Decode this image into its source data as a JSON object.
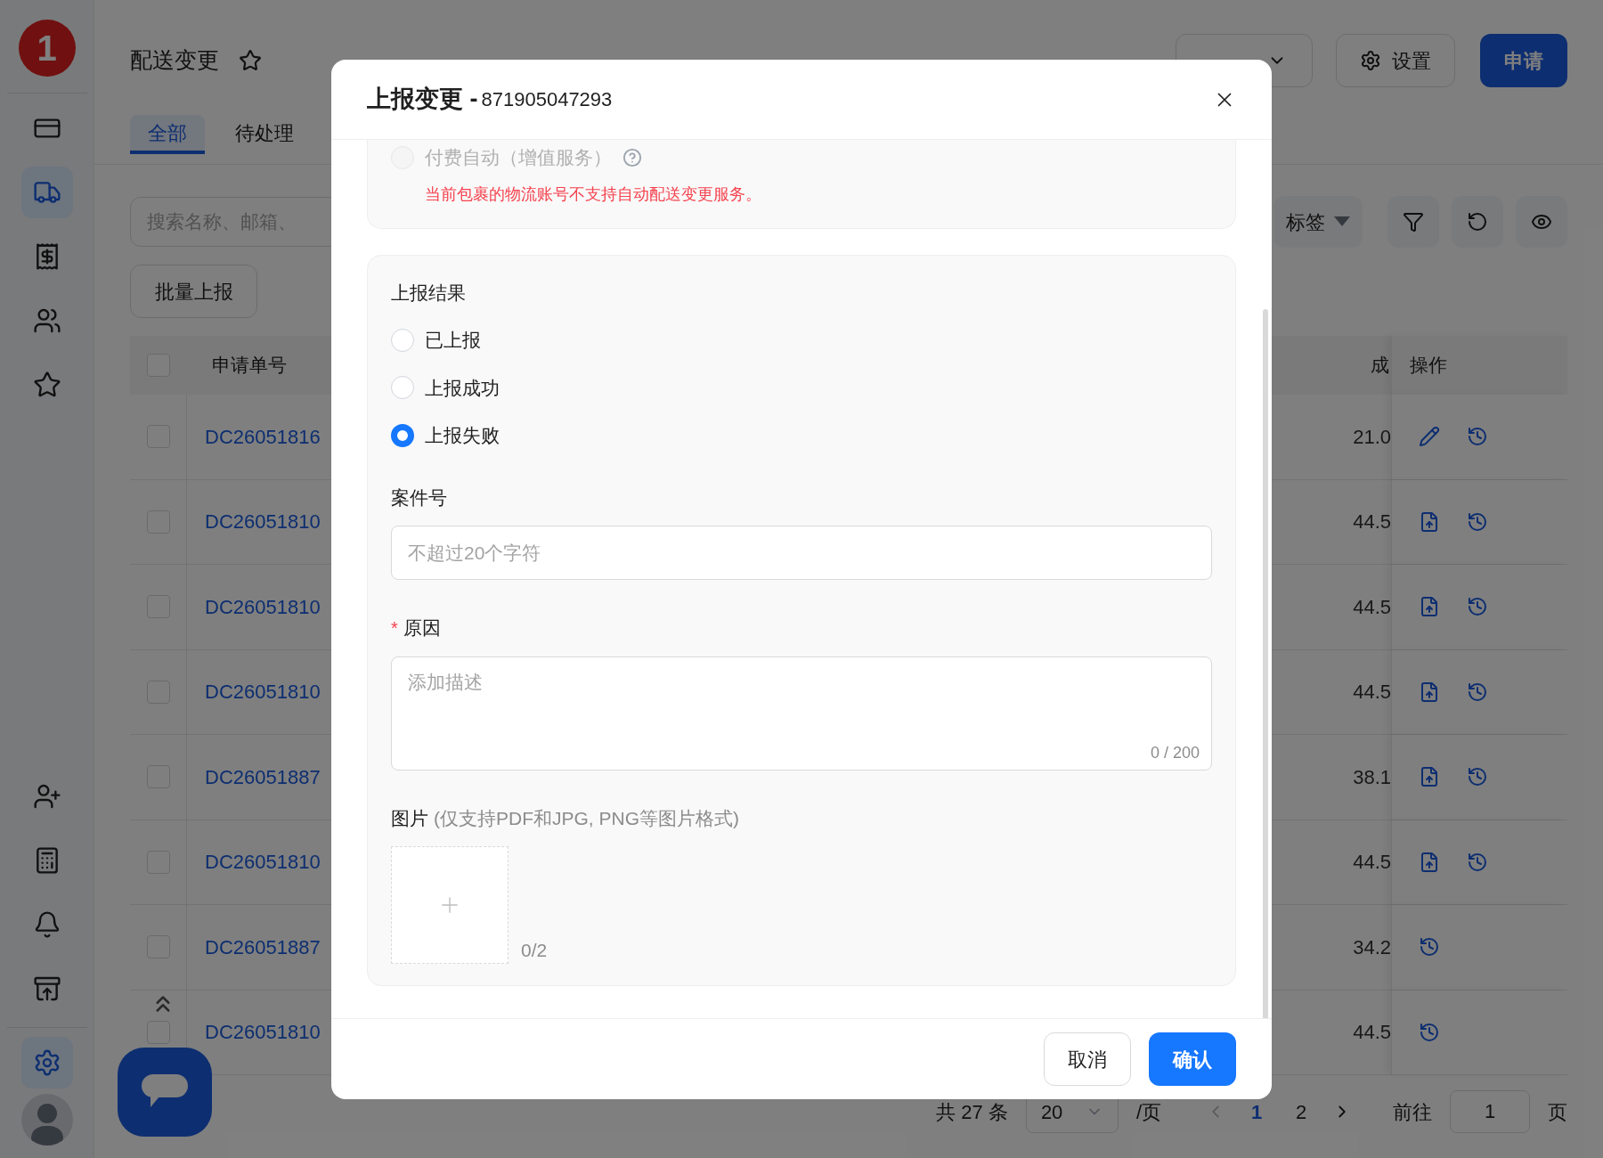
{
  "sidebar": {
    "logo": "1",
    "top_items": [
      {
        "selected": false
      },
      {
        "selected": true
      },
      {
        "selected": false
      },
      {
        "selected": false
      },
      {
        "selected": false
      }
    ],
    "bottom_items": [
      {
        "selected": false
      },
      {
        "selected": false
      },
      {
        "selected": false
      },
      {
        "selected": false
      },
      {
        "selected": true
      }
    ]
  },
  "header": {
    "title": "配送变更",
    "settings_button": "设置",
    "apply_button": "申请"
  },
  "tabs": [
    {
      "label": "全部",
      "selected": true
    },
    {
      "label": "待处理",
      "selected": false
    }
  ],
  "search": {
    "placeholder": "搜索名称、邮箱、"
  },
  "batch_button": "批量上报",
  "toolbar": {
    "tag_filter": "标签"
  },
  "table": {
    "columns": [
      "申请单号",
      "成",
      "操作"
    ],
    "select_all_checked": false,
    "rows": [
      {
        "checked": false,
        "id": "DC26051816",
        "amount": "21.0",
        "actions": [
          {
            "kind": "edit"
          },
          {
            "kind": "history"
          }
        ]
      },
      {
        "checked": false,
        "id": "DC26051810",
        "amount": "44.5",
        "actions": [
          {
            "kind": "upload"
          },
          {
            "kind": "history"
          }
        ]
      },
      {
        "checked": false,
        "id": "DC26051810",
        "amount": "44.5",
        "actions": [
          {
            "kind": "upload"
          },
          {
            "kind": "history"
          }
        ]
      },
      {
        "checked": false,
        "id": "DC26051810",
        "amount": "44.5",
        "actions": [
          {
            "kind": "upload"
          },
          {
            "kind": "history"
          }
        ]
      },
      {
        "checked": false,
        "id": "DC26051887",
        "amount": "38.1",
        "actions": [
          {
            "kind": "upload"
          },
          {
            "kind": "history"
          }
        ]
      },
      {
        "checked": false,
        "id": "DC26051810",
        "amount": "44.5",
        "actions": [
          {
            "kind": "upload"
          },
          {
            "kind": "history"
          }
        ]
      },
      {
        "checked": false,
        "id": "DC26051887",
        "amount": "34.2",
        "actions": [
          {
            "kind": "history"
          }
        ]
      },
      {
        "checked": false,
        "id": "DC26051810",
        "amount": "44.5",
        "actions": [
          {
            "kind": "history"
          }
        ]
      }
    ]
  },
  "pagination": {
    "total": "共 27 条",
    "page_size": "20",
    "per_page": "/页",
    "pages": [
      {
        "label": "1",
        "selected": true
      },
      {
        "label": "2",
        "selected": false
      }
    ],
    "goto": "前往",
    "goto_value": "1",
    "page_unit": "页"
  },
  "dialog": {
    "title": "上报变更 -",
    "order_number": "871905047293",
    "auto_option": {
      "label": "付费自动（增值服务）",
      "disabled": true,
      "selected": false
    },
    "auto_error": "当前包裹的物流账号不支持自动配送变更服务。",
    "result_label": "上报结果",
    "results": [
      {
        "label": "已上报",
        "selected": false
      },
      {
        "label": "上报成功",
        "selected": false
      },
      {
        "label": "上报失败",
        "selected": true
      }
    ],
    "case_label": "案件号",
    "case_placeholder": "不超过20个字符",
    "reason_label": "原因",
    "reason_required_mark": "*",
    "reason_placeholder": "添加描述",
    "reason_counter": "0 / 200",
    "image_label": "图片",
    "image_hint": "(仅支持PDF和JPG, PNG等图片格式)",
    "image_counter": "0/2",
    "cancel_button": "取消",
    "confirm_button": "确认"
  }
}
